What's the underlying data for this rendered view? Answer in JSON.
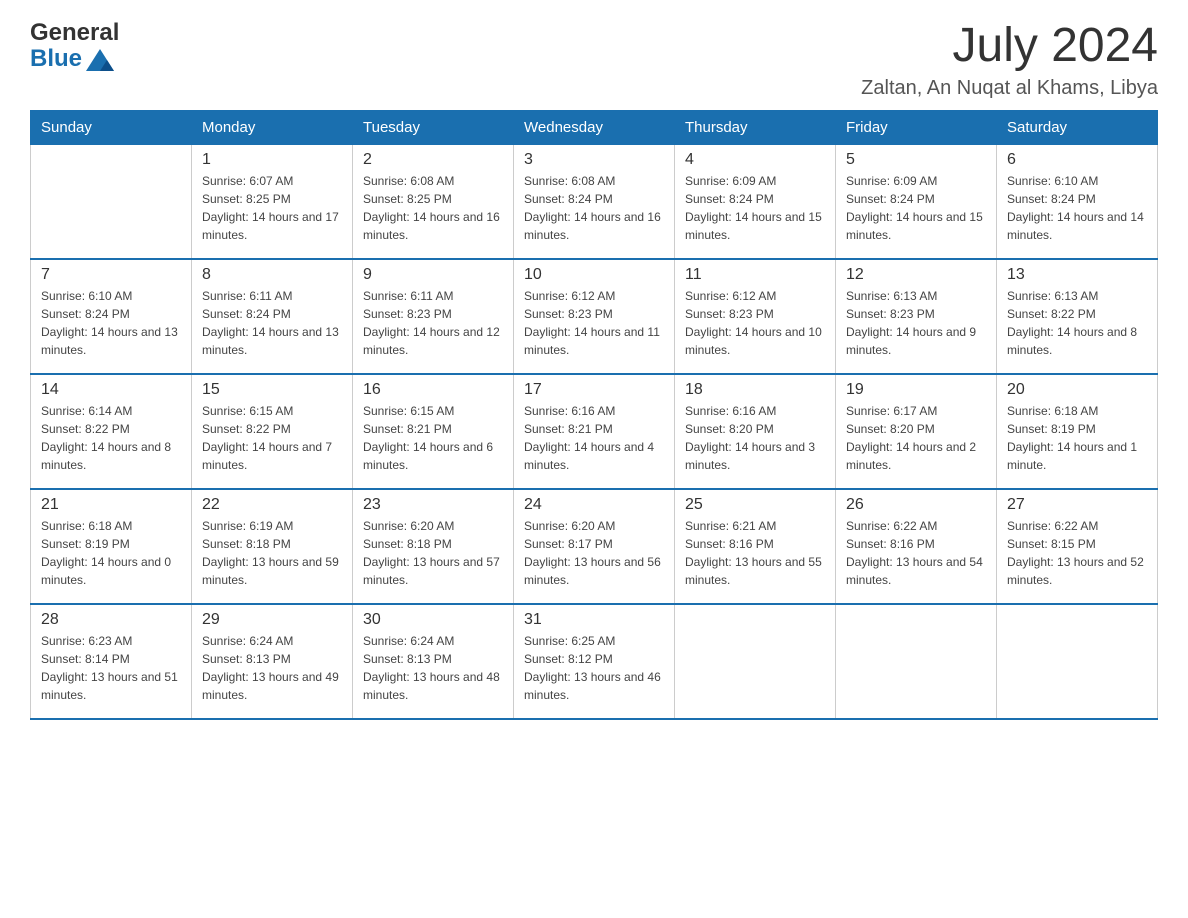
{
  "header": {
    "logo_text_general": "General",
    "logo_text_blue": "Blue",
    "month_year": "July 2024",
    "location": "Zaltan, An Nuqat al Khams, Libya"
  },
  "weekdays": [
    "Sunday",
    "Monday",
    "Tuesday",
    "Wednesday",
    "Thursday",
    "Friday",
    "Saturday"
  ],
  "weeks": [
    [
      {
        "day": "",
        "sunrise": "",
        "sunset": "",
        "daylight": ""
      },
      {
        "day": "1",
        "sunrise": "Sunrise: 6:07 AM",
        "sunset": "Sunset: 8:25 PM",
        "daylight": "Daylight: 14 hours and 17 minutes."
      },
      {
        "day": "2",
        "sunrise": "Sunrise: 6:08 AM",
        "sunset": "Sunset: 8:25 PM",
        "daylight": "Daylight: 14 hours and 16 minutes."
      },
      {
        "day": "3",
        "sunrise": "Sunrise: 6:08 AM",
        "sunset": "Sunset: 8:24 PM",
        "daylight": "Daylight: 14 hours and 16 minutes."
      },
      {
        "day": "4",
        "sunrise": "Sunrise: 6:09 AM",
        "sunset": "Sunset: 8:24 PM",
        "daylight": "Daylight: 14 hours and 15 minutes."
      },
      {
        "day": "5",
        "sunrise": "Sunrise: 6:09 AM",
        "sunset": "Sunset: 8:24 PM",
        "daylight": "Daylight: 14 hours and 15 minutes."
      },
      {
        "day": "6",
        "sunrise": "Sunrise: 6:10 AM",
        "sunset": "Sunset: 8:24 PM",
        "daylight": "Daylight: 14 hours and 14 minutes."
      }
    ],
    [
      {
        "day": "7",
        "sunrise": "Sunrise: 6:10 AM",
        "sunset": "Sunset: 8:24 PM",
        "daylight": "Daylight: 14 hours and 13 minutes."
      },
      {
        "day": "8",
        "sunrise": "Sunrise: 6:11 AM",
        "sunset": "Sunset: 8:24 PM",
        "daylight": "Daylight: 14 hours and 13 minutes."
      },
      {
        "day": "9",
        "sunrise": "Sunrise: 6:11 AM",
        "sunset": "Sunset: 8:23 PM",
        "daylight": "Daylight: 14 hours and 12 minutes."
      },
      {
        "day": "10",
        "sunrise": "Sunrise: 6:12 AM",
        "sunset": "Sunset: 8:23 PM",
        "daylight": "Daylight: 14 hours and 11 minutes."
      },
      {
        "day": "11",
        "sunrise": "Sunrise: 6:12 AM",
        "sunset": "Sunset: 8:23 PM",
        "daylight": "Daylight: 14 hours and 10 minutes."
      },
      {
        "day": "12",
        "sunrise": "Sunrise: 6:13 AM",
        "sunset": "Sunset: 8:23 PM",
        "daylight": "Daylight: 14 hours and 9 minutes."
      },
      {
        "day": "13",
        "sunrise": "Sunrise: 6:13 AM",
        "sunset": "Sunset: 8:22 PM",
        "daylight": "Daylight: 14 hours and 8 minutes."
      }
    ],
    [
      {
        "day": "14",
        "sunrise": "Sunrise: 6:14 AM",
        "sunset": "Sunset: 8:22 PM",
        "daylight": "Daylight: 14 hours and 8 minutes."
      },
      {
        "day": "15",
        "sunrise": "Sunrise: 6:15 AM",
        "sunset": "Sunset: 8:22 PM",
        "daylight": "Daylight: 14 hours and 7 minutes."
      },
      {
        "day": "16",
        "sunrise": "Sunrise: 6:15 AM",
        "sunset": "Sunset: 8:21 PM",
        "daylight": "Daylight: 14 hours and 6 minutes."
      },
      {
        "day": "17",
        "sunrise": "Sunrise: 6:16 AM",
        "sunset": "Sunset: 8:21 PM",
        "daylight": "Daylight: 14 hours and 4 minutes."
      },
      {
        "day": "18",
        "sunrise": "Sunrise: 6:16 AM",
        "sunset": "Sunset: 8:20 PM",
        "daylight": "Daylight: 14 hours and 3 minutes."
      },
      {
        "day": "19",
        "sunrise": "Sunrise: 6:17 AM",
        "sunset": "Sunset: 8:20 PM",
        "daylight": "Daylight: 14 hours and 2 minutes."
      },
      {
        "day": "20",
        "sunrise": "Sunrise: 6:18 AM",
        "sunset": "Sunset: 8:19 PM",
        "daylight": "Daylight: 14 hours and 1 minute."
      }
    ],
    [
      {
        "day": "21",
        "sunrise": "Sunrise: 6:18 AM",
        "sunset": "Sunset: 8:19 PM",
        "daylight": "Daylight: 14 hours and 0 minutes."
      },
      {
        "day": "22",
        "sunrise": "Sunrise: 6:19 AM",
        "sunset": "Sunset: 8:18 PM",
        "daylight": "Daylight: 13 hours and 59 minutes."
      },
      {
        "day": "23",
        "sunrise": "Sunrise: 6:20 AM",
        "sunset": "Sunset: 8:18 PM",
        "daylight": "Daylight: 13 hours and 57 minutes."
      },
      {
        "day": "24",
        "sunrise": "Sunrise: 6:20 AM",
        "sunset": "Sunset: 8:17 PM",
        "daylight": "Daylight: 13 hours and 56 minutes."
      },
      {
        "day": "25",
        "sunrise": "Sunrise: 6:21 AM",
        "sunset": "Sunset: 8:16 PM",
        "daylight": "Daylight: 13 hours and 55 minutes."
      },
      {
        "day": "26",
        "sunrise": "Sunrise: 6:22 AM",
        "sunset": "Sunset: 8:16 PM",
        "daylight": "Daylight: 13 hours and 54 minutes."
      },
      {
        "day": "27",
        "sunrise": "Sunrise: 6:22 AM",
        "sunset": "Sunset: 8:15 PM",
        "daylight": "Daylight: 13 hours and 52 minutes."
      }
    ],
    [
      {
        "day": "28",
        "sunrise": "Sunrise: 6:23 AM",
        "sunset": "Sunset: 8:14 PM",
        "daylight": "Daylight: 13 hours and 51 minutes."
      },
      {
        "day": "29",
        "sunrise": "Sunrise: 6:24 AM",
        "sunset": "Sunset: 8:13 PM",
        "daylight": "Daylight: 13 hours and 49 minutes."
      },
      {
        "day": "30",
        "sunrise": "Sunrise: 6:24 AM",
        "sunset": "Sunset: 8:13 PM",
        "daylight": "Daylight: 13 hours and 48 minutes."
      },
      {
        "day": "31",
        "sunrise": "Sunrise: 6:25 AM",
        "sunset": "Sunset: 8:12 PM",
        "daylight": "Daylight: 13 hours and 46 minutes."
      },
      {
        "day": "",
        "sunrise": "",
        "sunset": "",
        "daylight": ""
      },
      {
        "day": "",
        "sunrise": "",
        "sunset": "",
        "daylight": ""
      },
      {
        "day": "",
        "sunrise": "",
        "sunset": "",
        "daylight": ""
      }
    ]
  ]
}
